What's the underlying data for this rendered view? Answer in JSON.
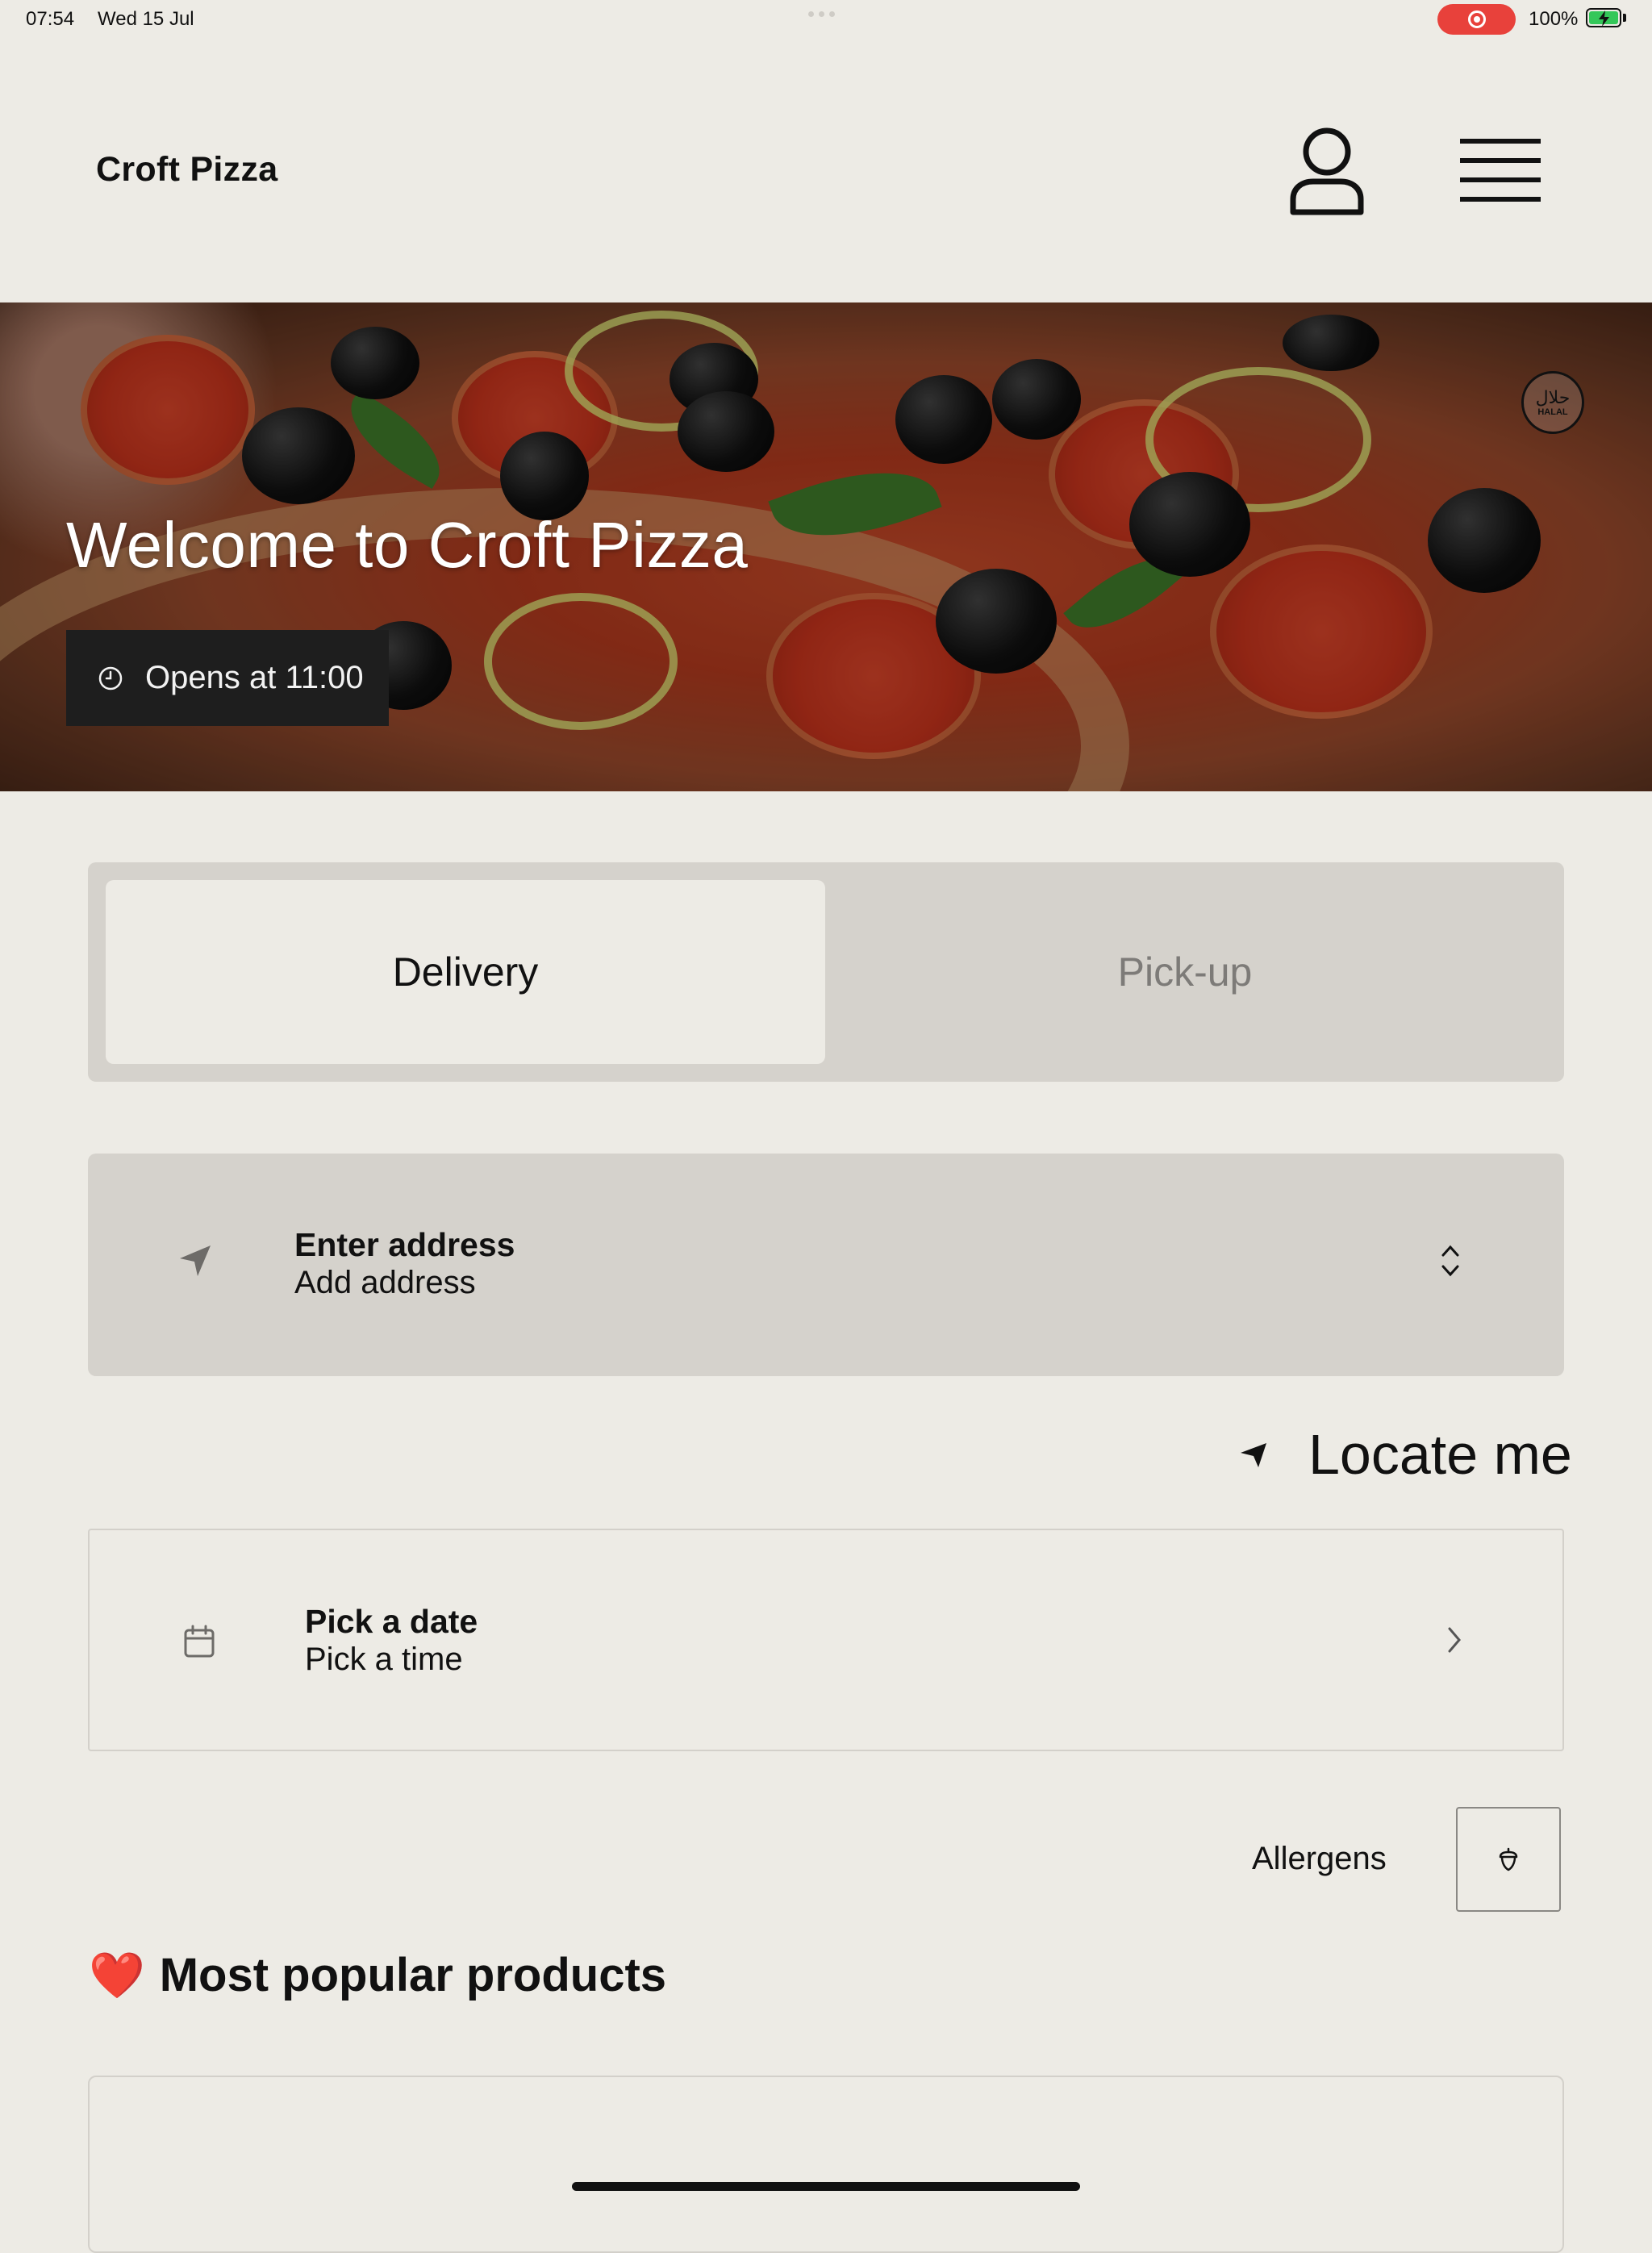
{
  "status_bar": {
    "time": "07:54",
    "date": "Wed 15 Jul",
    "battery": "100%",
    "recording_color": "#e8413b",
    "battery_color": "#34c759"
  },
  "header": {
    "brand": "Croft Pizza",
    "account_icon": "user-icon",
    "menu_icon": "hamburger-menu-icon"
  },
  "hero": {
    "title": "Welcome to Croft Pizza",
    "hours": "Opens at 11:00",
    "hours_icon": "clock-icon",
    "badge_arabic": "حلال",
    "badge_label": "HALAL"
  },
  "order_type": {
    "options": [
      "Delivery",
      "Pick-up"
    ],
    "selected": "Delivery"
  },
  "address": {
    "title": "Enter address",
    "subtitle": "Add address",
    "icon": "location-arrow-icon"
  },
  "locate": {
    "label": "Locate me"
  },
  "schedule": {
    "title": "Pick a date",
    "subtitle": "Pick a time",
    "icon": "calendar-icon"
  },
  "allergens": {
    "label": "Allergens",
    "icon": "acorn-icon"
  },
  "popular": {
    "emoji": "❤️",
    "title": "Most popular products"
  }
}
